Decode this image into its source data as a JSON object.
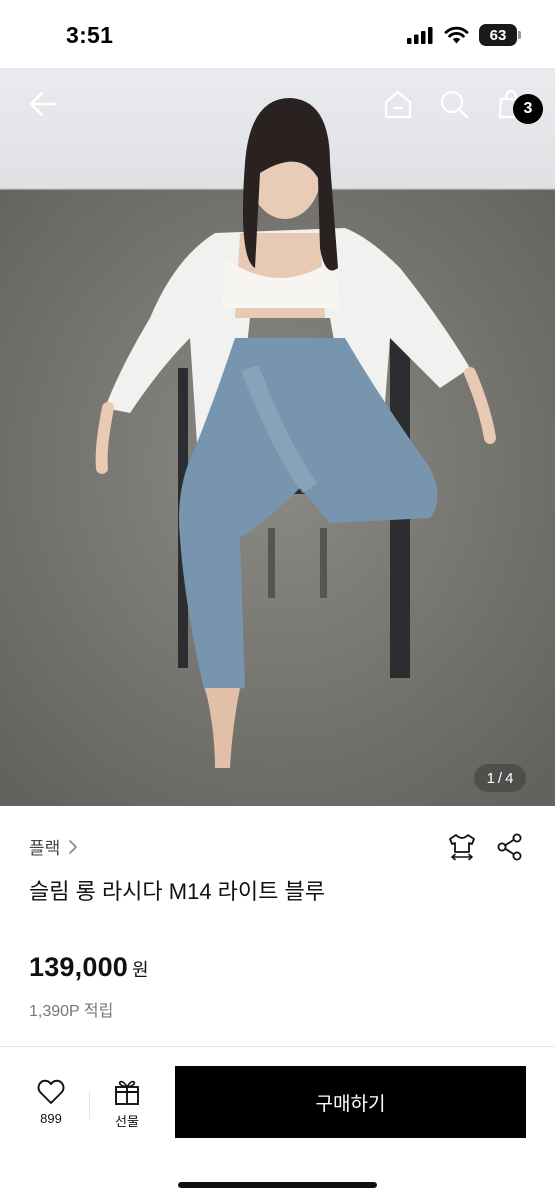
{
  "status_bar": {
    "time": "3:51",
    "battery": "63"
  },
  "header": {
    "cart_count": "3"
  },
  "gallery": {
    "current": "1",
    "separator": "/",
    "total": "4"
  },
  "product": {
    "brand": "플랙",
    "name": "슬림 롱 라시다 M14 라이트 블루",
    "price": "139,000",
    "currency": "원",
    "points": "1,390P 적립"
  },
  "actions": {
    "wish_count": "899",
    "gift_label": "선물",
    "buy_label": "구매하기"
  }
}
